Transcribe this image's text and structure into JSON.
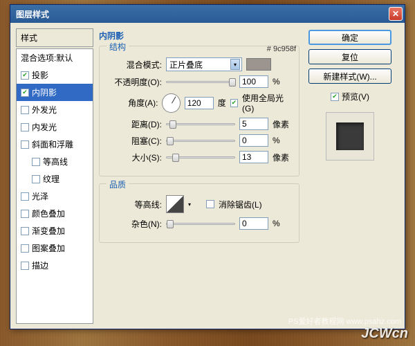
{
  "window": {
    "title": "图层样式"
  },
  "left": {
    "header": "样式",
    "blendDefault": "混合选项:默认",
    "items": [
      {
        "label": "投影",
        "checked": true,
        "selected": false
      },
      {
        "label": "内阴影",
        "checked": true,
        "selected": true
      },
      {
        "label": "外发光",
        "checked": false,
        "selected": false
      },
      {
        "label": "内发光",
        "checked": false,
        "selected": false
      },
      {
        "label": "斜面和浮雕",
        "checked": false,
        "selected": false
      },
      {
        "label": "等高线",
        "checked": false,
        "selected": false,
        "indent": true
      },
      {
        "label": "纹理",
        "checked": false,
        "selected": false,
        "indent": true
      },
      {
        "label": "光泽",
        "checked": false,
        "selected": false
      },
      {
        "label": "颜色叠加",
        "checked": false,
        "selected": false
      },
      {
        "label": "渐变叠加",
        "checked": false,
        "selected": false
      },
      {
        "label": "图案叠加",
        "checked": false,
        "selected": false
      },
      {
        "label": "描边",
        "checked": false,
        "selected": false
      }
    ]
  },
  "mid": {
    "title": "内阴影",
    "structure": {
      "legend": "结构",
      "blendModeLabel": "混合模式:",
      "blendModeValue": "正片叠底",
      "colorHex": "# 9c958f",
      "opacityLabel": "不透明度(O):",
      "opacityValue": "100",
      "percent": "%",
      "angleLabel": "角度(A):",
      "angleValue": "120",
      "angleUnit": "度",
      "globalLight": "使用全局光(G)",
      "distanceLabel": "距离(D):",
      "distanceValue": "5",
      "px": "像素",
      "chokeLabel": "阻塞(C):",
      "chokeValue": "0",
      "sizeLabel": "大小(S):",
      "sizeValue": "13"
    },
    "quality": {
      "legend": "品质",
      "contourLabel": "等高线:",
      "antiAlias": "消除锯齿(L)",
      "noiseLabel": "杂色(N):",
      "noiseValue": "0",
      "percent": "%"
    }
  },
  "right": {
    "ok": "确定",
    "cancel": "复位",
    "newStyle": "新建样式(W)...",
    "preview": "预览(V)"
  },
  "watermark": {
    "main": "JCWcn",
    "sub": "PS爱好者教程网   www.psahz.com"
  }
}
